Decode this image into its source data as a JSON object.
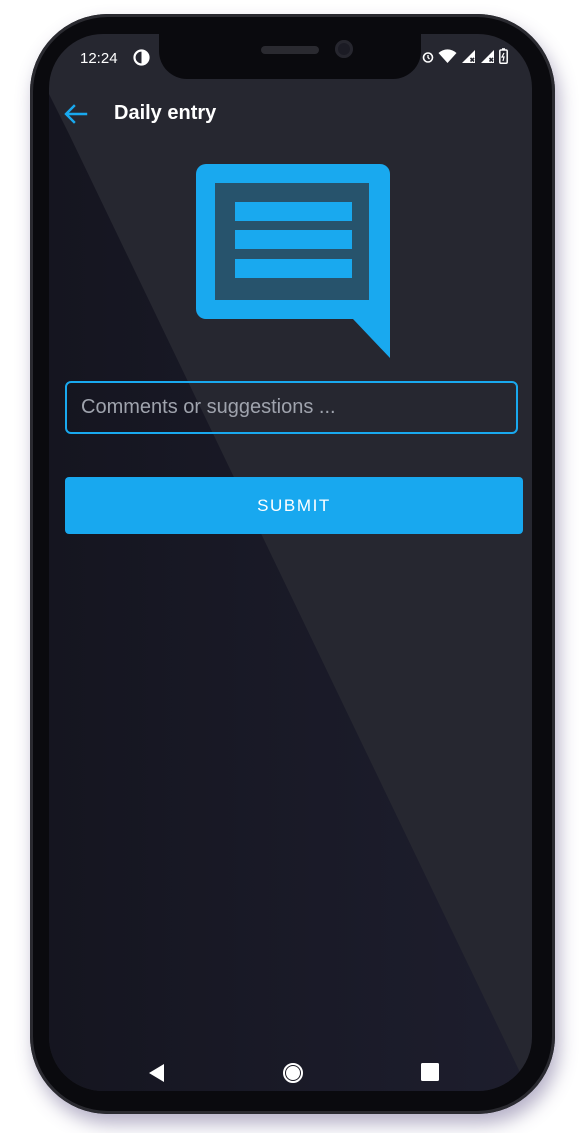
{
  "status_bar": {
    "time": "12:24",
    "icons": [
      "dnd-icon",
      "alarm-icon",
      "wifi-icon",
      "signal-icon",
      "signal-icon",
      "battery-icon"
    ]
  },
  "appbar": {
    "title": "Daily entry",
    "back_icon": "arrow-left-icon"
  },
  "hero_icon": "chat-bubble-lines-icon",
  "comment": {
    "value": "",
    "placeholder": "Comments or suggestions ..."
  },
  "submit": {
    "label": "SUBMIT"
  },
  "nav": {
    "back_icon": "triangle-back-icon",
    "home_icon": "circle-home-icon",
    "recents_icon": "square-recents-icon"
  },
  "colors": {
    "accent": "#19a9ef",
    "background": "#262730",
    "text": "#ffffff"
  }
}
